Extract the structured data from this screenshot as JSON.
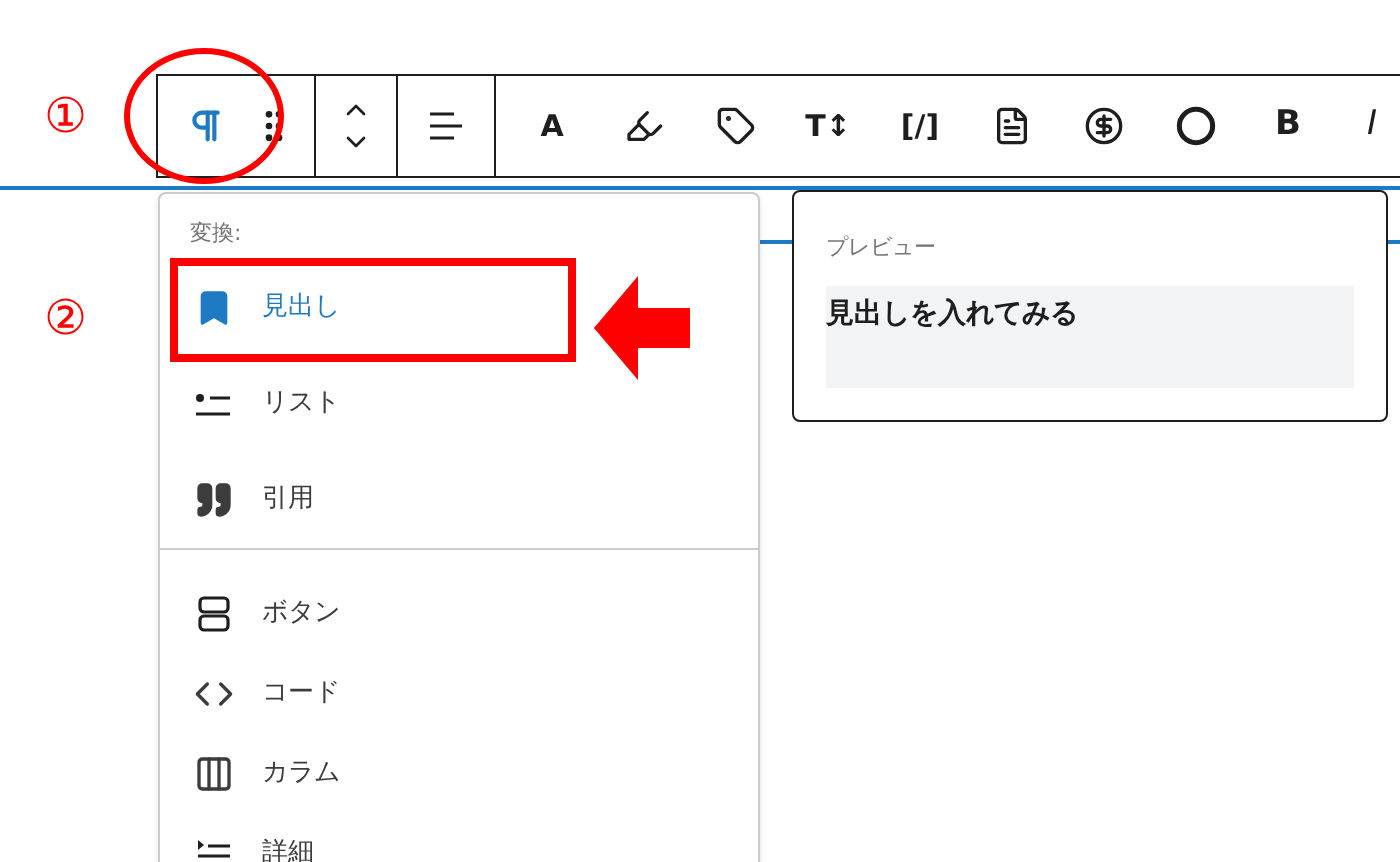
{
  "annotations": [
    {
      "label": "①"
    },
    {
      "label": "②"
    }
  ],
  "toolbar": {
    "groups": [
      {
        "items": [
          {
            "kind": "pilcrow",
            "selected": true
          },
          {
            "kind": "drag"
          }
        ]
      },
      {
        "items": [
          {
            "kind": "move"
          }
        ]
      },
      {
        "items": [
          {
            "kind": "align"
          }
        ]
      },
      {
        "items": [
          {
            "kind": "text",
            "label": "A"
          },
          {
            "kind": "highlight"
          },
          {
            "kind": "tag"
          },
          {
            "kind": "text",
            "label": "T↕"
          },
          {
            "kind": "text",
            "label": "[/]"
          },
          {
            "kind": "doc"
          },
          {
            "kind": "dollar"
          },
          {
            "kind": "circle"
          },
          {
            "kind": "bold",
            "label": "B"
          },
          {
            "kind": "italic",
            "label": "I"
          }
        ]
      }
    ]
  },
  "transform_menu": {
    "heading": "変換:",
    "sections": [
      [
        {
          "kind": "heading",
          "label": "見出し",
          "selected": true
        },
        {
          "kind": "list",
          "label": "リスト",
          "selected": false
        },
        {
          "kind": "quote",
          "label": "引用",
          "selected": false
        }
      ],
      [
        {
          "kind": "buttons",
          "label": "ボタン",
          "selected": false
        },
        {
          "kind": "code",
          "label": "コード",
          "selected": false
        },
        {
          "kind": "columns",
          "label": "カラム",
          "selected": false
        },
        {
          "kind": "details",
          "label": "詳細",
          "selected": false
        }
      ]
    ]
  },
  "preview": {
    "heading": "プレビュー",
    "content": "見出しを入れてみる"
  }
}
